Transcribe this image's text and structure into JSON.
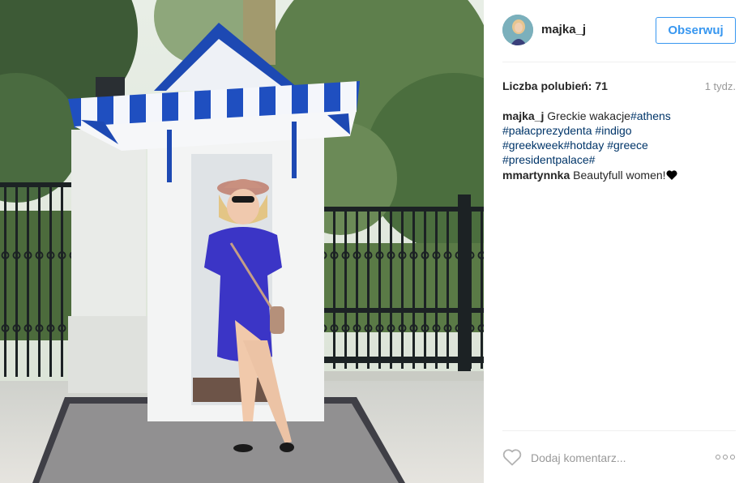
{
  "post": {
    "username": "majka_j",
    "follow_label": "Obserwuj",
    "likes_text": "Liczba polubień: 71",
    "time_ago": "1 tydz.",
    "caption": {
      "author": "majka_j",
      "text": "Greckie wakacje",
      "hashtags": [
        "#athens",
        "#pałacprezydenta",
        "#indigo",
        "#greekweek",
        "#hotday",
        "#greece",
        "#presidentpalace#"
      ]
    },
    "comments": [
      {
        "author": "mmartynnka",
        "text": "Beautyfull women!",
        "icon": "black-heart-icon"
      }
    ],
    "add_comment_placeholder": "Dodaj komentarz...",
    "like_icon": "heart-outline-icon",
    "more_icon": "more-options-icon"
  },
  "colors": {
    "link_blue": "#3897f0",
    "hashtag_blue": "#003569",
    "text": "#262626",
    "muted": "#999999",
    "divider": "#efefef"
  }
}
